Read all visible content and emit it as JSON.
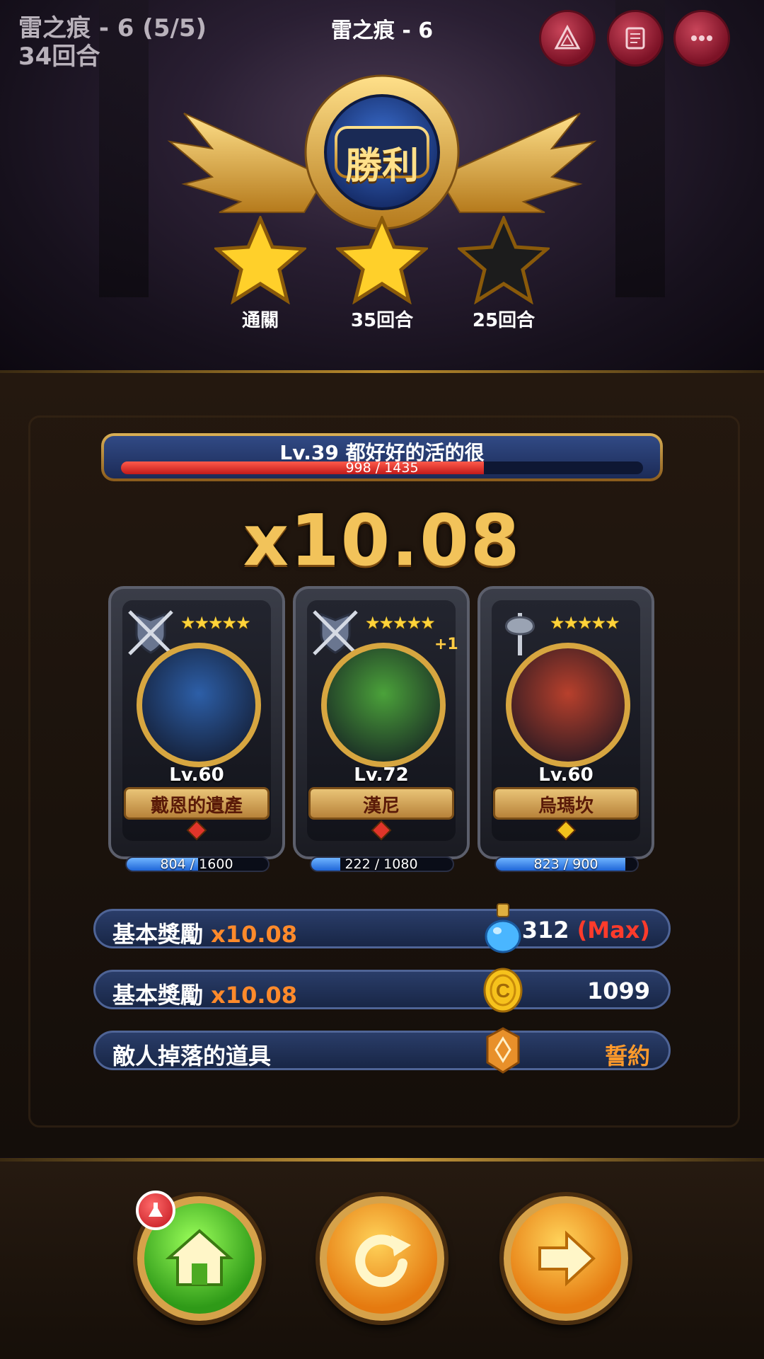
{
  "header": {
    "stage_name": "雷之痕 - 6 (5/5)",
    "turns_used": "34回合",
    "title": "雷之痕 - 6",
    "buttons": [
      "triangle-emblem-icon",
      "scroll-icon",
      "more-icon"
    ]
  },
  "result": {
    "emblem_text": "勝利",
    "stars": [
      {
        "label": "通關",
        "earned": true
      },
      {
        "label": "35回合",
        "earned": true
      },
      {
        "label": "25回合",
        "earned": false
      }
    ]
  },
  "player": {
    "level_name": "Lv.39  都好好的活的很",
    "exp_text": "998 / 1435",
    "exp_current": 998,
    "exp_max": 1435
  },
  "multiplier": "x10.08",
  "heroes": [
    {
      "stars": "★★★★★",
      "plus": "",
      "level": "Lv.60",
      "name": "戴恩的遺產",
      "hp_text": "804 / 1600",
      "hp_current": 804,
      "hp_max": 1600,
      "class_icon": "crossed-swords-shield-icon",
      "portrait_color": "#2d5fa8",
      "gem_color": "#e0352a"
    },
    {
      "stars": "★★★★★",
      "plus": "+1",
      "level": "Lv.72",
      "name": "漢尼",
      "hp_text": "222 / 1080",
      "hp_current": 222,
      "hp_max": 1080,
      "class_icon": "crossed-swords-shield-icon",
      "portrait_color": "#4ba23a",
      "gem_color": "#e0352a"
    },
    {
      "stars": "★★★★★",
      "plus": "",
      "level": "Lv.60",
      "name": "烏瑪坎",
      "hp_text": "823 / 900",
      "hp_current": 823,
      "hp_max": 900,
      "class_icon": "axe-icon",
      "portrait_color": "#b8402c",
      "gem_color": "#f2c21c"
    }
  ],
  "rewards": [
    {
      "label": "基本獎勵 ",
      "mult": "x10.08",
      "icon": "potion-icon",
      "value": "312",
      "suffix": " (Max)"
    },
    {
      "label": "基本獎勵 ",
      "mult": "x10.08",
      "icon": "coin-icon",
      "value": "1099",
      "suffix": ""
    },
    {
      "label": "敵人掉落的道具",
      "mult": "",
      "icon": "pledge-medal-icon",
      "value": "誓約",
      "suffix": ""
    }
  ],
  "actions": [
    "home-button",
    "retry-button",
    "next-button"
  ],
  "colors": {
    "accent_gold": "#f2c35a",
    "reward_orange": "#ff8a2b",
    "max_red": "#ff3b2b"
  }
}
